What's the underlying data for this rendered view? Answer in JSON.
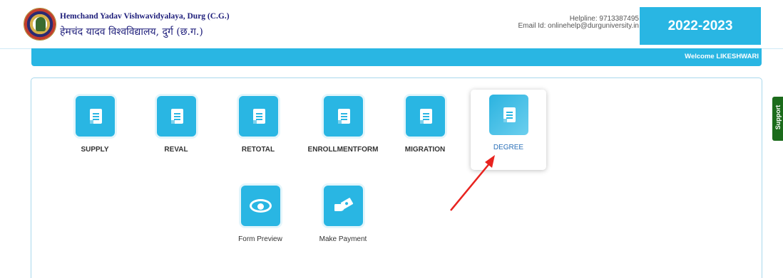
{
  "header": {
    "university_en": "Hemchand Yadav Vishwavidyalaya, Durg (C.G.)",
    "university_hi": "हेमचंद यादव विश्वविद्यालय, दुर्ग (छ.ग.)",
    "helpline": "Helpline: 9713387495",
    "email": "Email Id: onlinehelp@durguniversity.in",
    "year": "2022-2023"
  },
  "welcome": "Welcome LIKESHWARI",
  "tiles": [
    {
      "label": "SUPPLY",
      "icon": "document-icon"
    },
    {
      "label": "REVAL",
      "icon": "document-icon"
    },
    {
      "label": "RETOTAL",
      "icon": "document-icon"
    },
    {
      "label": "ENROLLMENTFORM",
      "icon": "document-icon"
    },
    {
      "label": "MIGRATION",
      "icon": "document-icon"
    },
    {
      "label": "DEGREE",
      "icon": "document-icon"
    },
    {
      "label": "Form Preview",
      "icon": "eye-icon"
    },
    {
      "label": "Make Payment",
      "icon": "payment-icon"
    }
  ],
  "support": "Support",
  "colors": {
    "accent": "#29b6e3",
    "support": "#1b6b1b",
    "arrow": "#e8231f"
  }
}
